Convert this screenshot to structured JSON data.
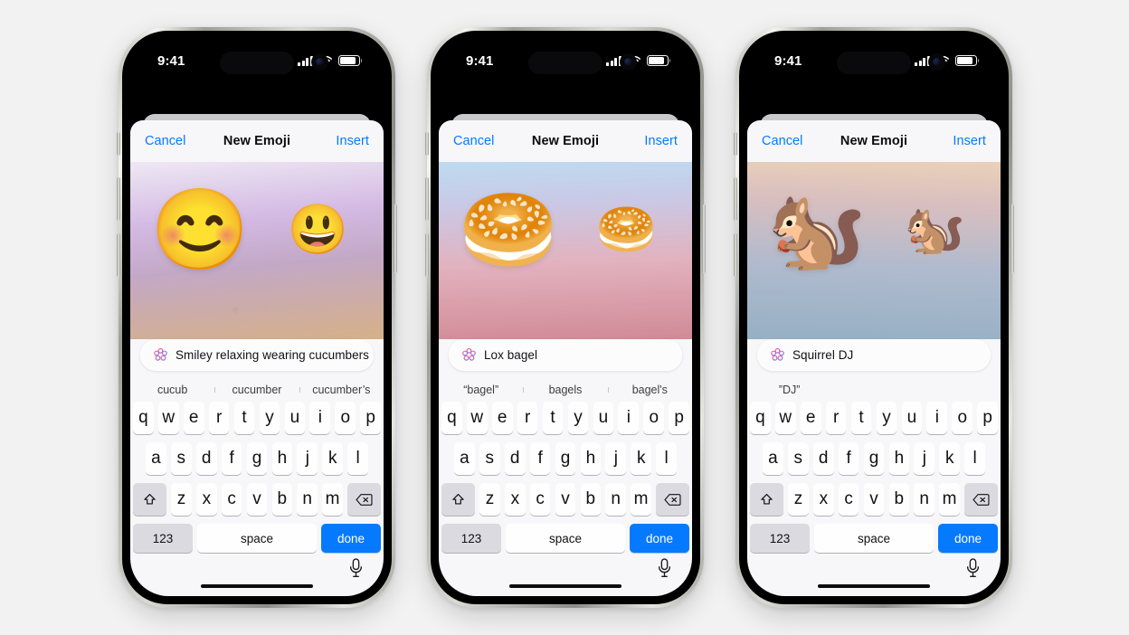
{
  "background_color": "#f2f2f2",
  "accent_color": "#067aff",
  "status_bar": {
    "time": "9:41",
    "cellular_icon": "signal-bars-icon",
    "wifi_icon": "wifi-icon",
    "battery_icon": "battery-icon"
  },
  "navbar": {
    "cancel_label": "Cancel",
    "title": "New Emoji",
    "insert_label": "Insert"
  },
  "keyboard": {
    "row1": [
      "q",
      "w",
      "e",
      "r",
      "t",
      "y",
      "u",
      "i",
      "o",
      "p"
    ],
    "row2": [
      "a",
      "s",
      "d",
      "f",
      "g",
      "h",
      "j",
      "k",
      "l"
    ],
    "row3": [
      "z",
      "x",
      "c",
      "v",
      "b",
      "n",
      "m"
    ],
    "shift_icon": "shift-icon",
    "backspace_icon": "backspace-icon",
    "numbers_label": "123",
    "space_label": "space",
    "done_label": "done",
    "mic_icon": "microphone-icon"
  },
  "field_icon": "apple-intelligence-icon",
  "page_dots": {
    "count": 4,
    "active_index": 0
  },
  "phones": [
    {
      "id": "phone-1",
      "prompt_text": "Smiley relaxing wearing cucumbers",
      "emoji_main": "🥒😊",
      "emoji_main_glyph": "😊",
      "emoji_next_glyph": "😃",
      "suggestions": [
        "cucub",
        "cucumber",
        "cucumber’s"
      ],
      "wash_gradient": "linear-gradient(175deg, rgba(247,247,249,0) 0%, rgba(228,214,238,.55) 22%, rgba(206,176,224,.85) 46%, rgba(192,164,196,.95) 66%, rgba(214,176,136,1) 100%)"
    },
    {
      "id": "phone-2",
      "prompt_text": "Lox bagel",
      "emoji_main": "🥯",
      "emoji_main_glyph": "🥯",
      "emoji_next_glyph": "🥯",
      "suggestions": [
        "“bagel”",
        "bagels",
        "bagel's"
      ],
      "wash_gradient": "linear-gradient(178deg, rgba(247,247,249,0) 0%, rgba(168,214,238,.75) 18%, rgba(196,196,228,.9) 40%, rgba(226,178,190,1) 66%, rgba(208,138,150,1) 100%)"
    },
    {
      "id": "phone-3",
      "prompt_text": "Squirrel DJ",
      "emoji_main": "🐿️",
      "emoji_main_glyph": "🐿️",
      "emoji_next_glyph": "🐿️",
      "suggestions": [
        "”DJ”",
        "",
        ""
      ],
      "wash_gradient": "linear-gradient(182deg, rgba(247,247,249,0) 0%, rgba(238,206,166,.8) 16%, rgba(214,186,186,.92) 40%, rgba(176,186,206,1) 68%, rgba(150,176,196,1) 100%)"
    }
  ]
}
